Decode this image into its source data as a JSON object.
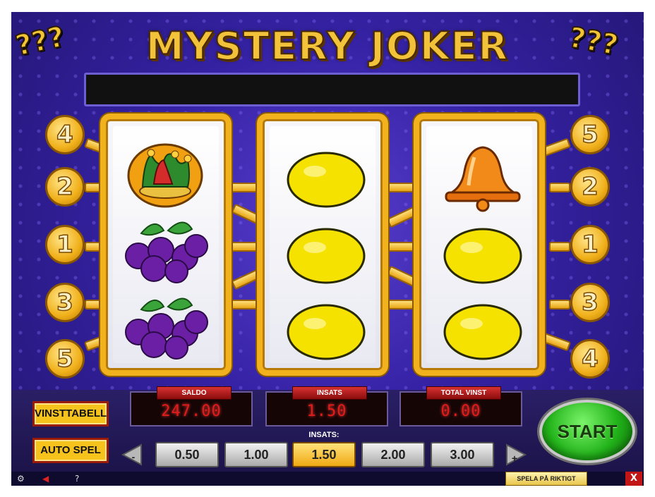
{
  "title": "MYSTERY JOKER",
  "left_line_numbers": [
    "4",
    "2",
    "1",
    "3",
    "5"
  ],
  "right_line_numbers": [
    "5",
    "2",
    "1",
    "3",
    "4"
  ],
  "reels": [
    [
      "joker-hat",
      "plum",
      "plum"
    ],
    [
      "lemon",
      "lemon",
      "lemon"
    ],
    [
      "bell",
      "lemon",
      "lemon"
    ]
  ],
  "buttons": {
    "paytable": "VINSTTABELL",
    "autoplay": "AUTO SPEL",
    "start": "START"
  },
  "displays": [
    {
      "label": "SALDO",
      "value": "247.00"
    },
    {
      "label": "INSATS",
      "value": "1.50"
    },
    {
      "label": "TOTAL VINST",
      "value": "0.00"
    }
  ],
  "bet": {
    "label": "INSATS:",
    "minus": "-",
    "plus": "+",
    "options": [
      "0.50",
      "1.00",
      "1.50",
      "2.00",
      "3.00"
    ],
    "selected_index": 2
  },
  "bottom": {
    "real_play": "SPELA PÅ RIKTIGT",
    "close": "X",
    "help": "?"
  },
  "colors": {
    "background": "#3522a4",
    "reel_frame": "#f1b21e",
    "start": "#22b31a",
    "display_text": "#e21b1b"
  }
}
